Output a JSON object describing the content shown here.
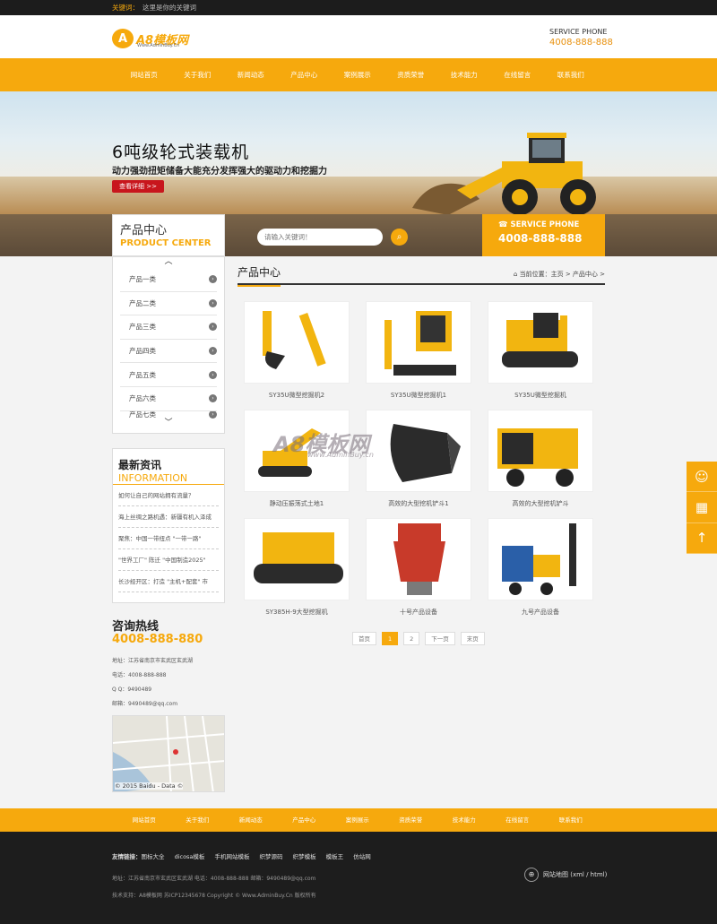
{
  "topbar": {
    "key_label": "关键词：",
    "key_text": "这里是你的关键词"
  },
  "header": {
    "logo_mark": "A",
    "logo_text": "A8模板网",
    "logo_sub": "Www.AdminBuy.Cn",
    "service_label": "SERVICE PHONE",
    "service_number": "4008-888-888"
  },
  "nav": {
    "items": [
      "网站首页",
      "关于我们",
      "新闻动态",
      "产品中心",
      "案例展示",
      "资质荣誉",
      "技术能力",
      "在线留言",
      "联系我们"
    ]
  },
  "banner": {
    "title": "6吨级轮式装载机",
    "subtitle": "动力强劲扭矩储备大能充分发挥强大的驱动力和挖掘力",
    "button": "查看详细 >>"
  },
  "search": {
    "cat_cn": "产品中心",
    "cat_en": "PRODUCT CENTER",
    "placeholder": "请输入关键词！",
    "service_label": "SERVICE PHONE",
    "service_number": "4008-888-888"
  },
  "categories": [
    "产品一类",
    "产品二类",
    "产品三类",
    "产品四类",
    "产品五类",
    "产品六类",
    "产品七类"
  ],
  "news": {
    "cn": "最新资讯",
    "en": "INFORMATION",
    "items": [
      "如何让自己的网站拥有流量？",
      "海上丝绸之路机遇：新疆有机入泽成",
      "聚焦：中国一带纽点 \"一带一路\"",
      "\"世界工厂\" 陈迁 \"中国制造2025\"",
      "长沙经开区：打造 \"主机+配套\" 市"
    ]
  },
  "contact": {
    "title": "咨询热线",
    "number": "4008-888-880",
    "address": "地址：江苏省南京市玄武区玄武湖",
    "phone": "电话：4008-888-888",
    "qq": "Q Q：9490489",
    "email": "邮箱：9490489@qq.com",
    "map_credit": "© 2015 Baidu - Data ©"
  },
  "content": {
    "title": "产品中心",
    "breadcrumb": "当前位置：主页 > 产品中心 >"
  },
  "products": [
    "SY35U微型挖掘机2",
    "SY35U微型挖掘机1",
    "SY35U微型挖掘机",
    "静动压振荡式土地1",
    "高效的大型挖机铲斗1",
    "高效的大型挖机铲斗",
    "SY385H-9大型挖掘机",
    "十号产品设备",
    "九号产品设备"
  ],
  "pager": {
    "first": "首页",
    "p1": "1",
    "p2": "2",
    "next": "下一页",
    "last": "末页"
  },
  "footer": {
    "nav": [
      "网站首页",
      "关于我们",
      "新闻动态",
      "产品中心",
      "案例展示",
      "资质荣誉",
      "技术能力",
      "在线留言",
      "联系我们"
    ],
    "links_label": "友情链接：",
    "links": "图标大全 dicosa模板 手机网站模板 织梦源码 织梦模板 模板王 仿站网",
    "address": "地址：江苏省南京市玄武区玄武湖  电话：4008-888-888  邮箱：9490489@qq.com",
    "copyright": "技术支持：A8模板网 苏ICP12345678  Copyright © Www.AdminBuy.Cn 版权所有",
    "sitemap": "网站地图 (xml / html)"
  },
  "watermark": {
    "main": "A8模板网",
    "sub": "www.AdminBuy.cn"
  },
  "colors": {
    "accent": "#f6a90d",
    "dark": "#1d1d1d"
  }
}
